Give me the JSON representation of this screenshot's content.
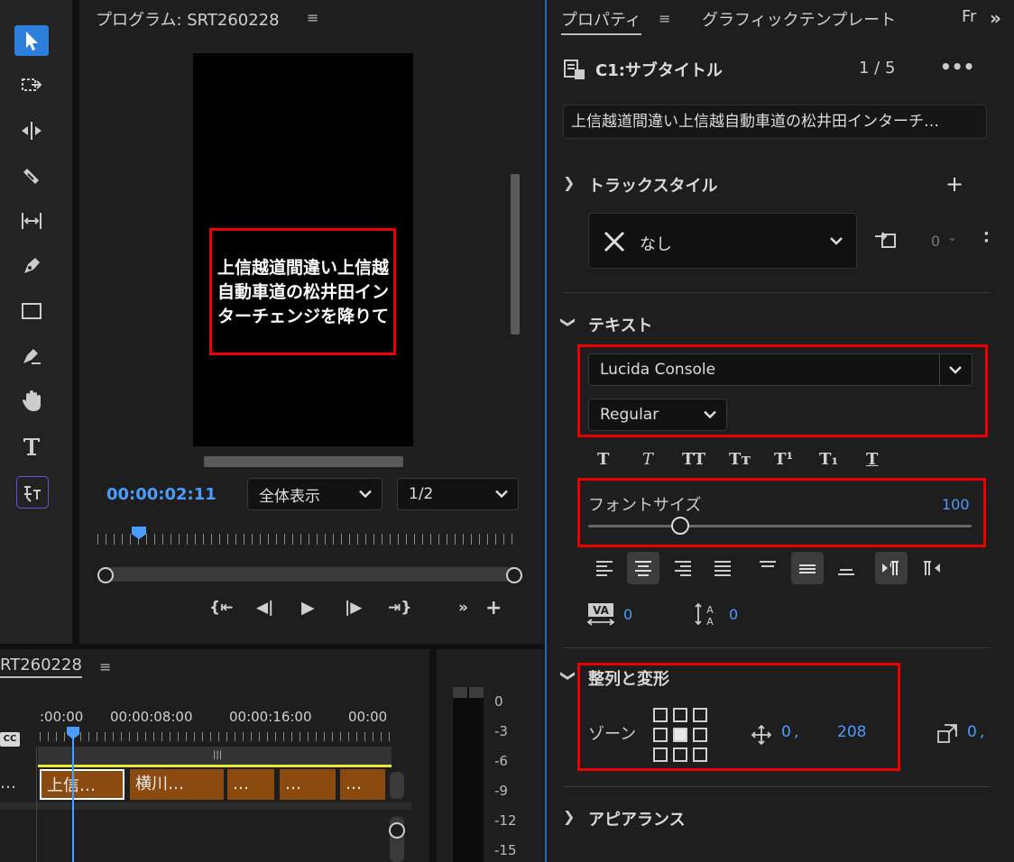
{
  "program": {
    "title": "プログラム: SRT260228",
    "caption": "上信越道間違い上信越自動車道の松井田インターチェンジを降りて",
    "timecode": "00:00:02:11",
    "zoom": "全体表示",
    "resolution": "1/2"
  },
  "timeline": {
    "title": "RT260228",
    "cc_label": "CC",
    "ruler": [
      ":00:00",
      "00:00:08:00",
      "00:00:16:00",
      "00:00"
    ],
    "clips": [
      "上信…",
      "横川…",
      "…",
      "…",
      "…"
    ],
    "track_dots": "…"
  },
  "meter": {
    "labels": [
      "0",
      "-3",
      "-6",
      "-9",
      "-12",
      "-15"
    ]
  },
  "props": {
    "tab_properties": "プロパティ",
    "tab_graphics": "グラフィックテンプレート",
    "tab_more": "Fr",
    "caption_name": "C1:サブタイトル",
    "caption_index": "1 / 5",
    "caption_text": "上信越道間違い上信越自動車道の松井田インターチ…",
    "track_style": {
      "title": "トラックスタイル",
      "value": "なし",
      "count": "0"
    },
    "text": {
      "title": "テキスト",
      "font": "Lucida Console",
      "style": "Regular",
      "format_buttons": [
        "T",
        "T",
        "TT",
        "Tт",
        "T¹",
        "T₁",
        "T"
      ],
      "font_size_label": "フォントサイズ",
      "font_size": "100",
      "font_size_fraction": 0.24,
      "kerning": "0",
      "leading": "0"
    },
    "align": {
      "title": "整列と変形",
      "zone_label": "ゾーン",
      "pos_x": "0",
      "pos_y": "208",
      "scale": "0"
    },
    "appearance": {
      "title": "アピアランス"
    }
  },
  "colors": {
    "accent": "#4a9cff",
    "clip": "#8a4a10",
    "highlight": "#e00000"
  }
}
